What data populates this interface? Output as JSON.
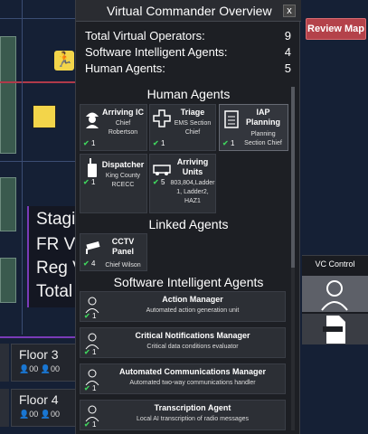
{
  "panel": {
    "title": "Virtual Commander Overview",
    "close_label": "x"
  },
  "summary": [
    {
      "label": "Total Virtual Operators:",
      "value": "9"
    },
    {
      "label": "Software Intelligent Agents:",
      "value": "4"
    },
    {
      "label": "Human Agents:",
      "value": "5"
    }
  ],
  "sections": {
    "human": "Human Agents",
    "linked": "Linked Agents",
    "software": "Software Intelligent Agents"
  },
  "human_agents": [
    {
      "name": "Arriving IC",
      "desc": "Chief\nRobertson",
      "count": "1",
      "icon": "firefighter-icon"
    },
    {
      "name": "Triage",
      "desc": "EMS Section\nChief",
      "count": "1",
      "icon": "medical-cross-icon"
    },
    {
      "name": "IAP\nPlanning",
      "desc": "Planning\nSection Chief",
      "count": "1",
      "icon": "clipboard-icon"
    },
    {
      "name": "Dispatcher",
      "desc": "King County\nRCECC",
      "count": "1",
      "icon": "radio-icon"
    },
    {
      "name": "Arriving\nUnits",
      "desc": "803,804,Ladder\n1, Ladder2,\nHAZ1",
      "count": "5",
      "icon": "fire-truck-icon"
    }
  ],
  "linked_agents": [
    {
      "name": "CCTV\nPanel",
      "desc": "Chief Wilson",
      "count": "4",
      "icon": "camera-icon"
    }
  ],
  "software_agents": [
    {
      "name": "Action Manager",
      "desc": "Automated action generation unit",
      "count": "1"
    },
    {
      "name": "Critical Notifications Manager",
      "desc": "Critical data conditions evaluator",
      "count": "1"
    },
    {
      "name": "Automated Communications Manager",
      "desc": "Automated two-way communications handler",
      "count": "1"
    },
    {
      "name": "Transcription Agent",
      "desc": "Local AI transcription of radio messages",
      "count": "1"
    }
  ],
  "map_info": [
    "Stagi",
    "FR Ve",
    "Reg V",
    "Total"
  ],
  "floors": [
    {
      "name": "Floor 3",
      "stat1": "00",
      "stat2": "00"
    },
    {
      "name": "Floor 4",
      "stat1": "00",
      "stat2": "00"
    }
  ],
  "review_map_label": "Review Map",
  "vc_control_label": "VC Control",
  "check_mark": "✔"
}
